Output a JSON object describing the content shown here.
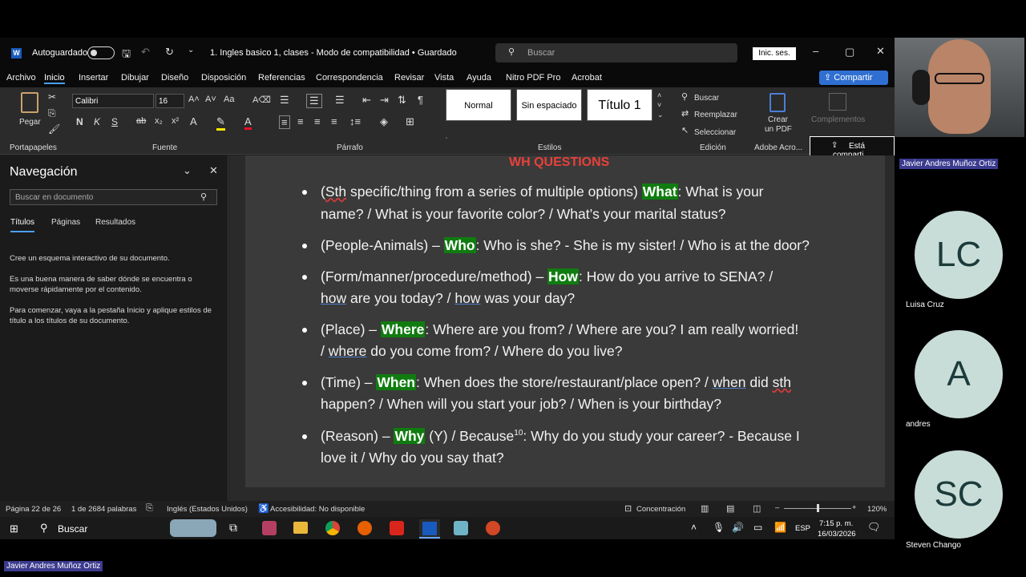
{
  "window": {
    "autosave_label": "Autoguardado",
    "doc_title": "1. Ingles basico 1, clases  -  Modo de compatibilidad  •  Guardado",
    "search_placeholder": "Buscar",
    "signin_label": "Inic. ses.",
    "share_label": "Compartir"
  },
  "menu": [
    "Archivo",
    "Inicio",
    "Insertar",
    "Dibujar",
    "Diseño",
    "Disposición",
    "Referencias",
    "Correspondencia",
    "Revisar",
    "Vista",
    "Ayuda",
    "Nitro PDF Pro",
    "Acrobat"
  ],
  "ribbon": {
    "paste": "Pegar",
    "font_name": "Calibri",
    "font_size": "16",
    "styles": [
      "Normal",
      "Sin espaciado",
      "Título 1"
    ],
    "find": "Buscar",
    "replace": "Reemplazar",
    "select": "Seleccionar",
    "create_pdf_1": "Crear",
    "create_pdf_2": "un PDF",
    "complements": "Complementos",
    "sharing": "Está comparti",
    "groups": [
      "Portapapeles",
      "Fuente",
      "Párrafo",
      "Estilos",
      "Edición",
      "Adobe Acro..."
    ]
  },
  "nav": {
    "title": "Navegación",
    "search_placeholder": "Buscar en documento",
    "tabs": [
      "Títulos",
      "Páginas",
      "Resultados"
    ],
    "p1": "Cree un esquema interactivo de su documento.",
    "p2": "Es una buena manera de saber dónde se encuentra o moverse rápidamente por el contenido.",
    "p3": "Para comenzar, vaya a la pestaña Inicio y aplique estilos de título a los títulos de su documento."
  },
  "doc": {
    "heading": "WH QUESTIONS",
    "what": {
      "pre": "(Sth specific/thing from a series of multiple options) ",
      "sth": "Sth",
      "pre2": " specific/thing from a series of multiple options) ",
      "kw": "What",
      "post1": ": What is your",
      "line2": "name? / What is your favorite color? / What’s your marital status?"
    },
    "who": {
      "pre": "(People-Animals) – ",
      "kw": "Who",
      "post": ": Who is she? - She is my sister! / Who is at the door?"
    },
    "how": {
      "pre": "(Form/manner/procedure/method) – ",
      "kw": "How",
      "post": ": How do you arrive to SENA? /",
      "l2a": "how",
      "l2b": " are you today? / ",
      "l2c": "how",
      "l2d": " was your day?"
    },
    "where": {
      "pre": "(Place) – ",
      "kw": "Where",
      "post": ": Where are you from? / Where are you? I am really worried!",
      "l2a": "/ ",
      "l2b": "where",
      "l2c": " do you come from? / Where do you live?"
    },
    "when": {
      "pre": "(Time) – ",
      "kw": "When",
      "post": ": When does the store/restaurant/place open? / ",
      "u1": "when",
      "mid": " did ",
      "sth": "sth",
      "line2": "happen? / When will you start your job? / When is your birthday?"
    },
    "why": {
      "pre": "(Reason) – ",
      "kw": "Why",
      "post": " (Y) / Because",
      "sup": "10",
      "post2": ": Why do you study your career? - Because I",
      "line2": "love it / Why do you say that?"
    }
  },
  "status": {
    "page": "Página 22 de 26",
    "words": "1 de 2684 palabras",
    "lang": "Inglés (Estados Unidos)",
    "access": "Accesibilidad: No disponible",
    "focus": "Concentración",
    "zoom": "120%"
  },
  "taskbar": {
    "search": "Buscar",
    "lang": "ESP",
    "time": "7:15 p. m.",
    "date": "16/03/2026"
  },
  "participants": [
    {
      "name": "Javier Andres Muñoz Ortiz"
    },
    {
      "initials": "LC",
      "name": "Luisa Cruz"
    },
    {
      "initials": "A",
      "name": "andres"
    },
    {
      "initials": "SC",
      "name": "Steven Chango"
    }
  ],
  "speaker_label": "Javier Andres Muñoz Ortiz"
}
